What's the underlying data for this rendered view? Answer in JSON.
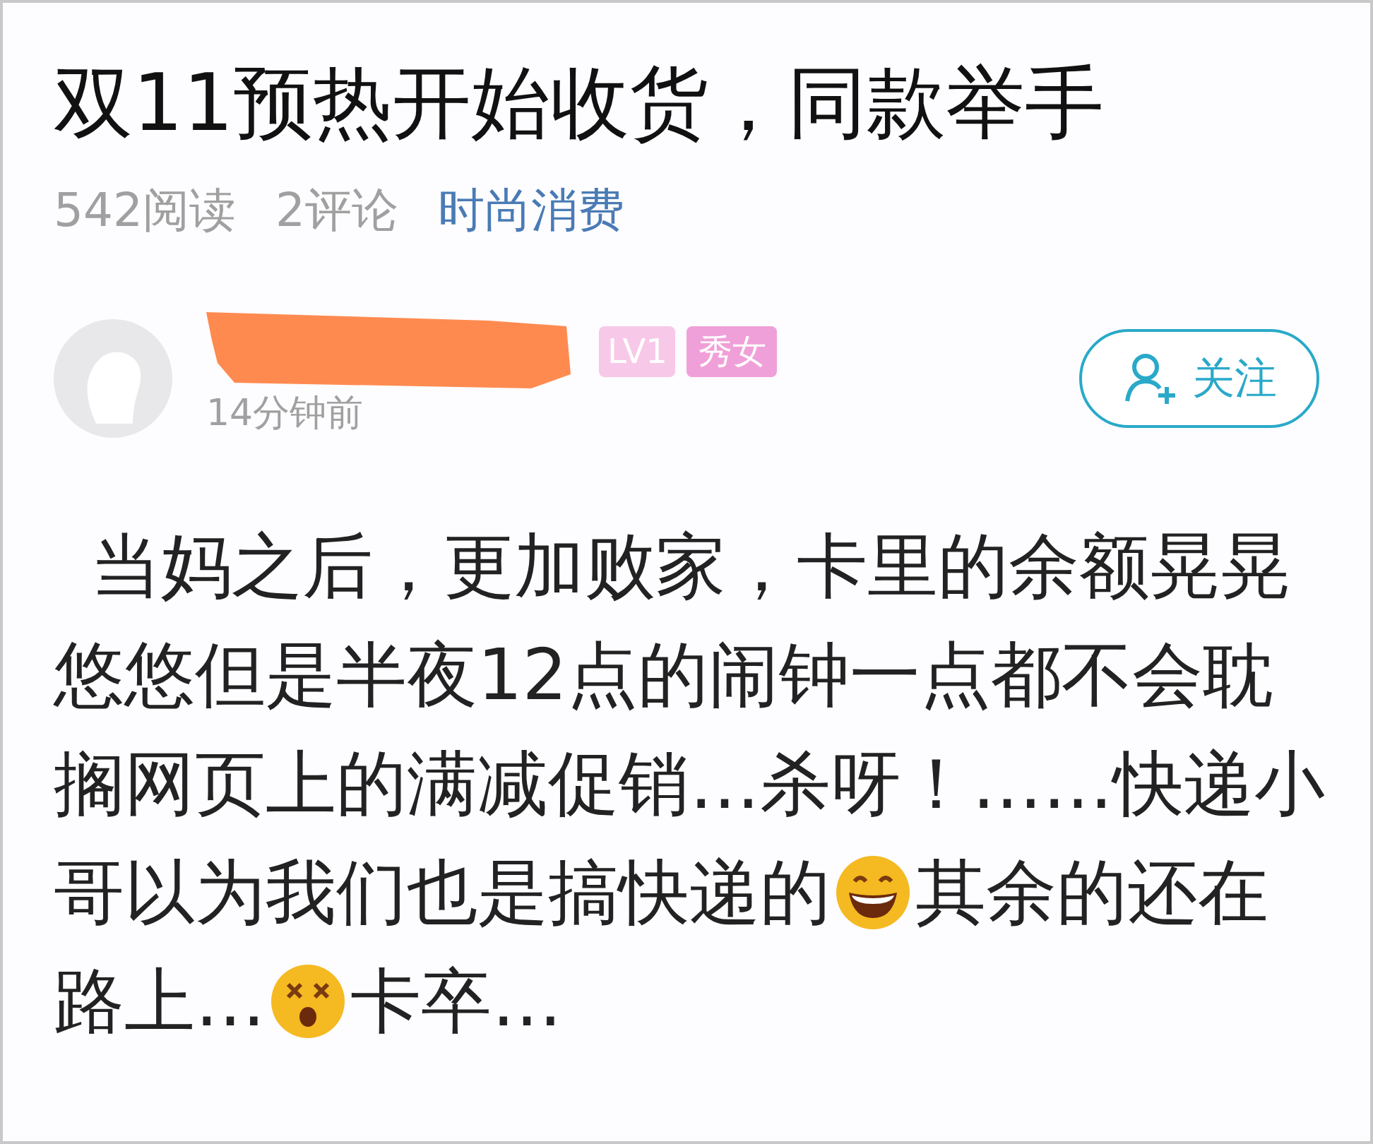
{
  "post": {
    "title": "双11预热开始收货，同款举手",
    "reads": "542阅读",
    "comments": "2评论",
    "topic": "时尚消费"
  },
  "author": {
    "level_badge": "LV1",
    "tag": "秀女",
    "time": "14分钟前",
    "follow_button": "关注"
  },
  "body_lines": [
    [
      {
        "kind": "text",
        "text": "当妈之后，更加败家，卡里的余额晃晃"
      }
    ],
    [
      {
        "kind": "text",
        "text": "悠悠但是半夜12点的闹钟一点都不会耽"
      }
    ],
    [
      {
        "kind": "text",
        "text": "搁网页上的满减促销…杀呀！……快递小"
      }
    ],
    [
      {
        "kind": "text",
        "text": "哥以为我们也是搞快递的"
      },
      {
        "kind": "grin"
      },
      {
        "kind": "text",
        "text": "其余的还在"
      }
    ],
    [
      {
        "kind": "text",
        "text": "路上…"
      },
      {
        "kind": "dizzy"
      },
      {
        "kind": "text",
        "text": "卡卒…"
      }
    ]
  ]
}
